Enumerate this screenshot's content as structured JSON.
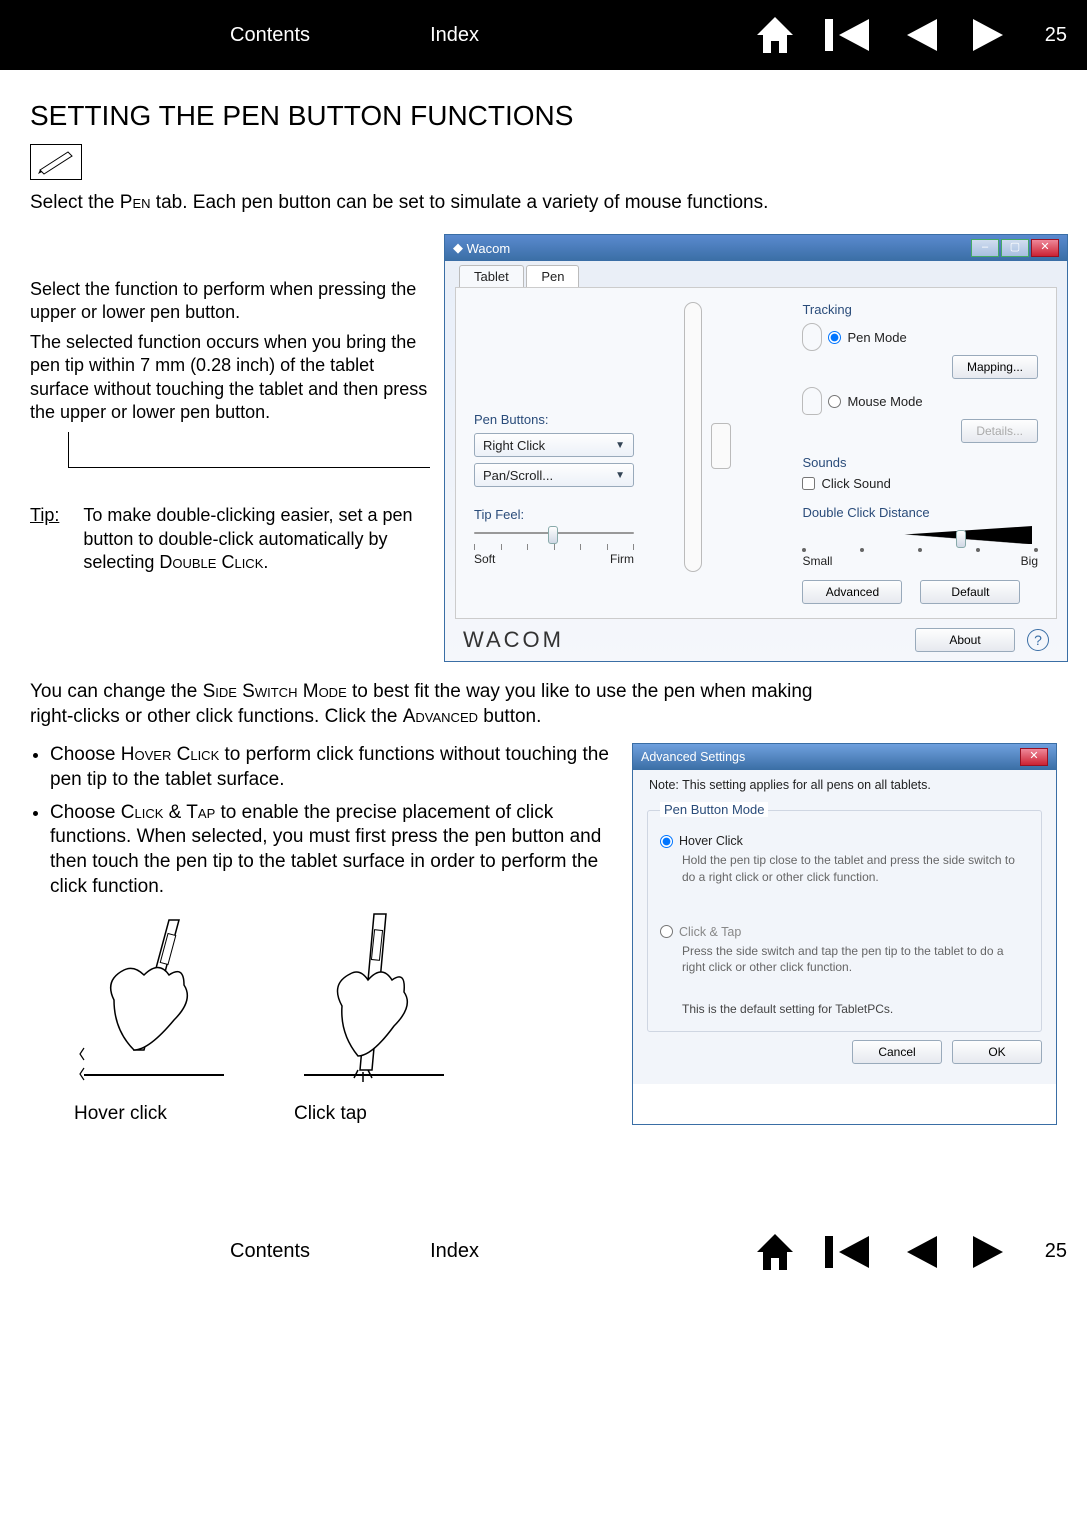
{
  "nav": {
    "contents": "Contents",
    "index": "Index",
    "page": "25"
  },
  "heading": "SETTING THE PEN BUTTON FUNCTIONS",
  "intro_pre": "Select the ",
  "intro_pen": "Pen",
  "intro_post": " tab. Each pen button can be set to simulate a variety of mouse functions.",
  "left": {
    "p1": "Select the function to perform when pressing the upper or lower pen button.",
    "p2": "The selected function occurs when you bring the pen tip within 7 mm (0.28 inch) of the tablet surface without touching the tablet and then press the upper or lower pen button."
  },
  "tip": {
    "label": "Tip:",
    "text_pre": "To make double-clicking easier, set a pen button to double-click automatically by selecting ",
    "text_sc": "Double Click",
    "text_post": "."
  },
  "wacom": {
    "title": "Wacom",
    "tabs": {
      "tablet": "Tablet",
      "pen": "Pen"
    },
    "penButtonsLabel": "Pen Buttons:",
    "dd1": "Right Click",
    "dd2": "Pan/Scroll...",
    "tipFeel": "Tip Feel:",
    "soft": "Soft",
    "firm": "Firm",
    "tracking": "Tracking",
    "penMode": "Pen Mode",
    "mapping": "Mapping...",
    "mouseMode": "Mouse Mode",
    "details": "Details...",
    "sounds": "Sounds",
    "clickSound": "Click Sound",
    "dcd": "Double Click Distance",
    "small": "Small",
    "big": "Big",
    "advanced": "Advanced",
    "default": "Default",
    "brand": "WACOM",
    "about": "About"
  },
  "midtext": {
    "pre": "You can change the ",
    "sc1": "Side Switch Mode",
    "mid": " to best fit the way you like to use the pen when making right-clicks or other click functions. Click the ",
    "sc2": "Advanced",
    "post": " button."
  },
  "bullets": {
    "b1_pre": "Choose ",
    "b1_sc": "Hover Click",
    "b1_post": " to perform click functions without touching the pen tip to the tablet surface.",
    "b2_pre": "Choose ",
    "b2_sc": "Click & Tap",
    "b2_post": " to enable the precise placement of click functions. When selected, you must first press the pen button and then touch the pen tip to the tablet surface in order to perform the click function."
  },
  "fig": {
    "hover": "Hover click",
    "tap": "Click tap"
  },
  "adv": {
    "title": "Advanced Settings",
    "note": "Note: This setting applies for all pens on all tablets.",
    "group": "Pen Button Mode",
    "hover": "Hover Click",
    "hover_desc": "Hold the pen tip close to the tablet and press the side switch to do a right click or other click function.",
    "tap": "Click & Tap",
    "tap_desc": "Press the side switch and tap the pen tip to the tablet to do a right click or other click function.",
    "default_note": "This is the default setting for TabletPCs.",
    "cancel": "Cancel",
    "ok": "OK"
  }
}
